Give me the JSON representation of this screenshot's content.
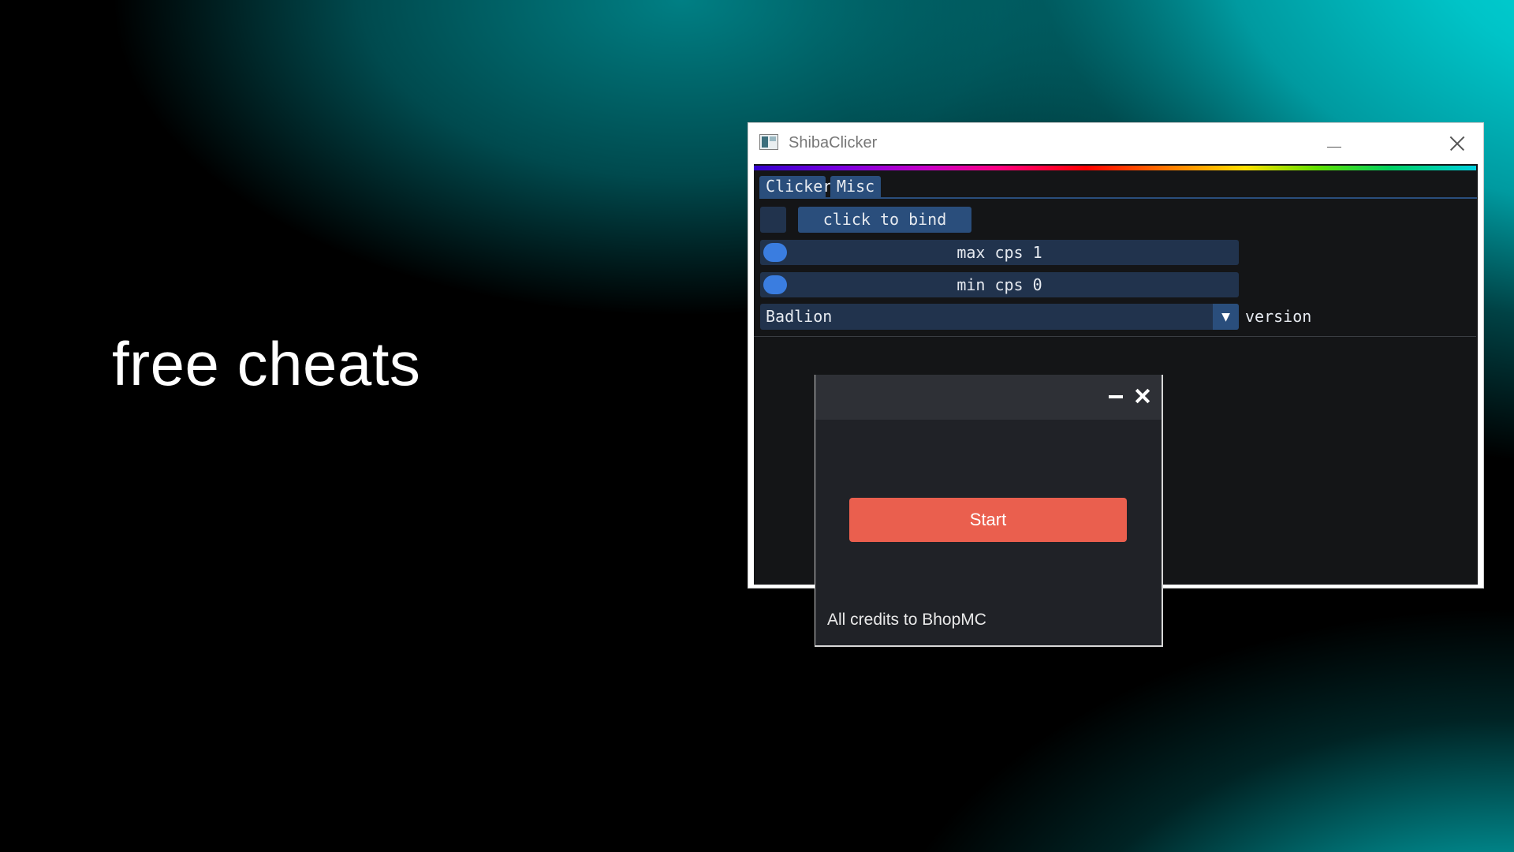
{
  "headline": "free cheats",
  "main_window": {
    "title": "ShibaClicker",
    "tabs": [
      {
        "label": "Clicker"
      },
      {
        "label": "Misc"
      }
    ],
    "bind_button": "click to bind",
    "sliders": [
      {
        "label": "max cps 1",
        "value": 1
      },
      {
        "label": "min cps 0",
        "value": 0
      }
    ],
    "combo": {
      "selected": "Badlion",
      "label": "version"
    },
    "colors": {
      "tab": "#2a4e7c",
      "frame": "#21334d",
      "knob": "#3a7de0",
      "background": "#141517"
    }
  },
  "dialog": {
    "start_label": "Start",
    "credits": "All credits to BhopMC",
    "colors": {
      "start": "#ea5f4e",
      "background": "#202227"
    }
  },
  "icons": [
    "app-icon",
    "minimize-icon",
    "close-icon",
    "chevron-down-icon"
  ]
}
